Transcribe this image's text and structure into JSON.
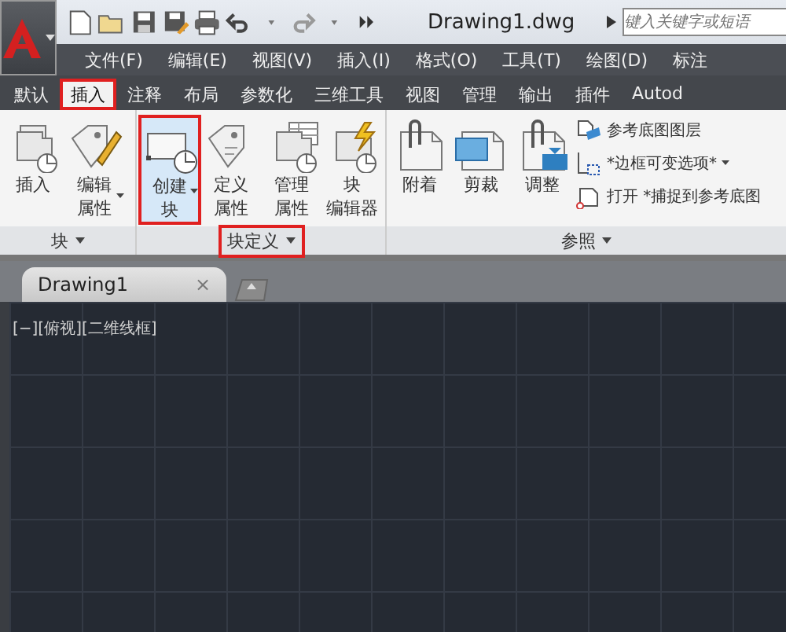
{
  "title_bar": {
    "document_title": "Drawing1.dwg",
    "search": {
      "placeholder": "键入关键字或短语"
    }
  },
  "menu_bar": [
    "文件(F)",
    "编辑(E)",
    "视图(V)",
    "插入(I)",
    "格式(O)",
    "工具(T)",
    "绘图(D)",
    "标注"
  ],
  "ribbon_tabs": [
    {
      "label": "默认",
      "selected": false,
      "highlighted": false
    },
    {
      "label": "插入",
      "selected": true,
      "highlighted": true
    },
    {
      "label": "注释",
      "selected": false,
      "highlighted": false
    },
    {
      "label": "布局",
      "selected": false,
      "highlighted": false
    },
    {
      "label": "参数化",
      "selected": false,
      "highlighted": false
    },
    {
      "label": "三维工具",
      "selected": false,
      "highlighted": false
    },
    {
      "label": "视图",
      "selected": false,
      "highlighted": false
    },
    {
      "label": "管理",
      "selected": false,
      "highlighted": false
    },
    {
      "label": "输出",
      "selected": false,
      "highlighted": false
    },
    {
      "label": "插件",
      "selected": false,
      "highlighted": false
    },
    {
      "label": "Autod",
      "selected": false,
      "highlighted": false
    }
  ],
  "ribbon_panels": [
    {
      "title": "块",
      "highlighted": false,
      "tools": [
        {
          "kind": "insert",
          "lines": [
            "插入"
          ],
          "dropdown": false,
          "selected": false,
          "highlighted": false
        },
        {
          "kind": "edit-attribute",
          "lines": [
            "编辑",
            "属性"
          ],
          "dropdown": true,
          "selected": false,
          "highlighted": false
        }
      ]
    },
    {
      "title": "块定义",
      "highlighted": true,
      "tools": [
        {
          "kind": "create-block",
          "lines": [
            "创建",
            "块"
          ],
          "dropdown": true,
          "selected": true,
          "highlighted": true
        },
        {
          "kind": "define-attribute",
          "lines": [
            "定义",
            "属性"
          ],
          "dropdown": false,
          "selected": false,
          "highlighted": false
        },
        {
          "kind": "manage-attribute",
          "lines": [
            "管理",
            "属性"
          ],
          "dropdown": false,
          "selected": false,
          "highlighted": false
        },
        {
          "kind": "block-editor",
          "lines": [
            "块",
            "编辑器"
          ],
          "dropdown": false,
          "selected": false,
          "highlighted": false
        }
      ]
    },
    {
      "title": "参照",
      "highlighted": false,
      "tools": [
        {
          "kind": "attach",
          "lines": [
            "附着"
          ],
          "dropdown": false,
          "selected": false,
          "highlighted": false
        },
        {
          "kind": "clip",
          "lines": [
            "剪裁"
          ],
          "dropdown": false,
          "selected": false,
          "highlighted": false
        },
        {
          "kind": "adjust",
          "lines": [
            "调整"
          ],
          "dropdown": false,
          "selected": false,
          "highlighted": false
        }
      ],
      "small_tools": [
        {
          "kind": "layers",
          "texts": [
            "参考底图图层"
          ],
          "dropdown": false
        },
        {
          "kind": "frame",
          "texts": [
            "*边框可变选项*"
          ],
          "dropdown": true
        },
        {
          "kind": "snap",
          "texts": [
            "打开",
            "*捕捉到参考底图"
          ],
          "dropdown": false
        }
      ]
    }
  ],
  "document_tabs": [
    {
      "label": "Drawing1",
      "selected": true,
      "close": "×"
    }
  ],
  "viewport": {
    "label": "[−][俯视][二维线框]"
  }
}
